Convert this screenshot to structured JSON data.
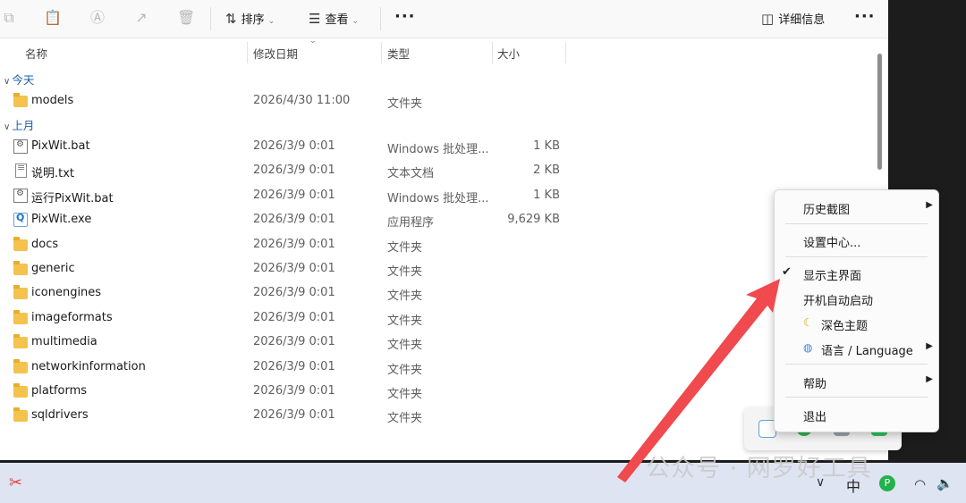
{
  "toolbar": {
    "sort_label": "排序",
    "view_label": "查看",
    "details_label": "详细信息"
  },
  "columns": {
    "name": "名称",
    "date": "修改日期",
    "type": "类型",
    "size": "大小"
  },
  "groups": {
    "today": {
      "label": "今天"
    },
    "last_month": {
      "label": "上月"
    }
  },
  "files_today": [
    {
      "name": "models",
      "date": "2026/4/30 11:00",
      "type": "文件夹",
      "size": "",
      "icon": "folder-icon"
    }
  ],
  "files_last_month": [
    {
      "name": "PixWit.bat",
      "date": "2026/3/9 0:01",
      "type": "Windows 批处理...",
      "size": "1 KB",
      "icon": "batch-file-icon"
    },
    {
      "name": "说明.txt",
      "date": "2026/3/9 0:01",
      "type": "文本文档",
      "size": "2 KB",
      "icon": "text-file-icon"
    },
    {
      "name": "运行PixWit.bat",
      "date": "2026/3/9 0:01",
      "type": "Windows 批处理...",
      "size": "1 KB",
      "icon": "batch-file-icon"
    },
    {
      "name": "PixWit.exe",
      "date": "2026/3/9 0:01",
      "type": "应用程序",
      "size": "9,629 KB",
      "icon": "exe-file-icon"
    },
    {
      "name": "docs",
      "date": "2026/3/9 0:01",
      "type": "文件夹",
      "size": "",
      "icon": "folder-icon"
    },
    {
      "name": "generic",
      "date": "2026/3/9 0:01",
      "type": "文件夹",
      "size": "",
      "icon": "folder-icon"
    },
    {
      "name": "iconengines",
      "date": "2026/3/9 0:01",
      "type": "文件夹",
      "size": "",
      "icon": "folder-icon"
    },
    {
      "name": "imageformats",
      "date": "2026/3/9 0:01",
      "type": "文件夹",
      "size": "",
      "icon": "folder-icon"
    },
    {
      "name": "multimedia",
      "date": "2026/3/9 0:01",
      "type": "文件夹",
      "size": "",
      "icon": "folder-icon"
    },
    {
      "name": "networkinformation",
      "date": "2026/3/9 0:01",
      "type": "文件夹",
      "size": "",
      "icon": "folder-icon"
    },
    {
      "name": "platforms",
      "date": "2026/3/9 0:01",
      "type": "文件夹",
      "size": "",
      "icon": "folder-icon"
    },
    {
      "name": "sqldrivers",
      "date": "2026/3/9 0:01",
      "type": "文件夹",
      "size": "",
      "icon": "folder-icon"
    }
  ],
  "context_menu": {
    "history": "历史截图",
    "settings": "设置中心...",
    "show_main": "显示主界面",
    "autostart": "开机自动启动",
    "dark_theme": "深色主题",
    "language": "语言 / Language",
    "help": "帮助",
    "exit": "退出"
  },
  "taskbar": {
    "ime": "中"
  },
  "watermark": "公众号 · 网罗好工具",
  "colors": {
    "accent_arrow": "#f0494e",
    "folder": "#f3c34e",
    "taskbar": "#dfe4f2"
  }
}
